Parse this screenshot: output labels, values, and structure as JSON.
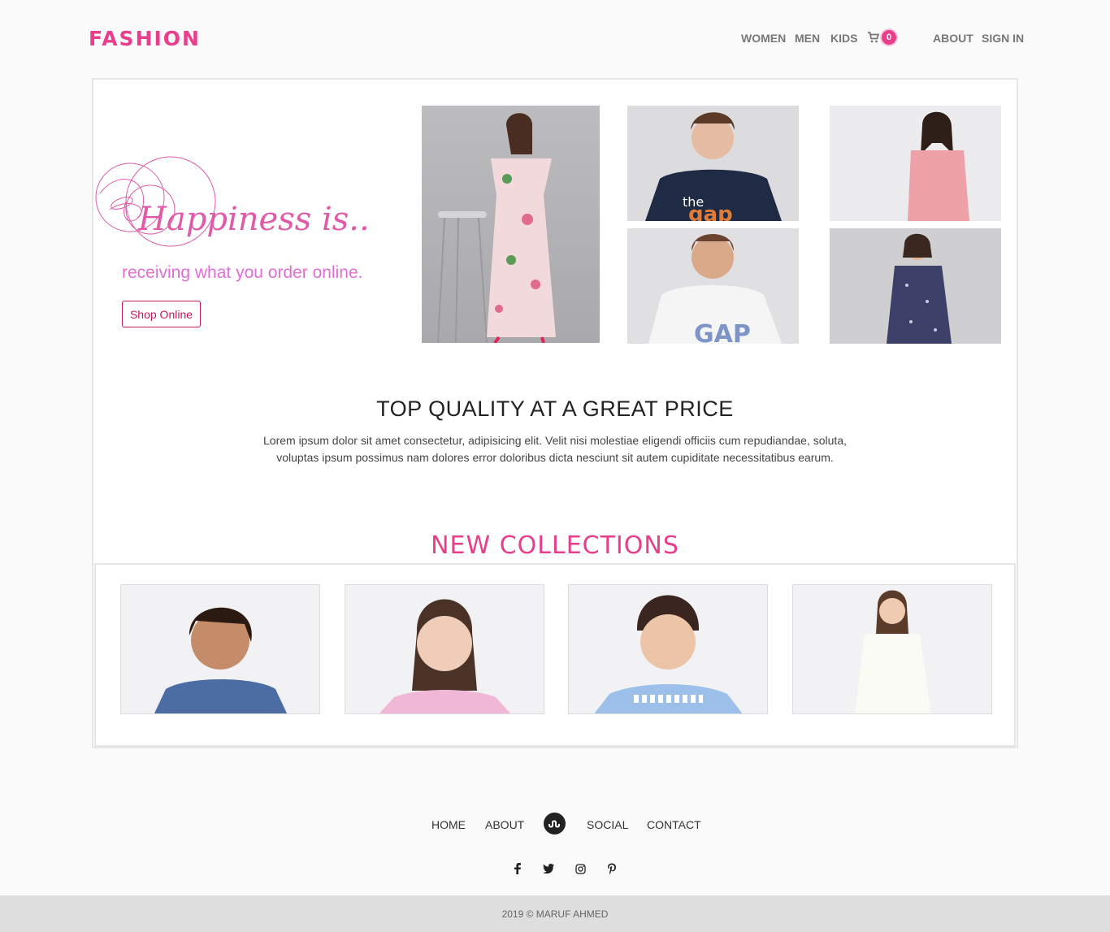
{
  "header": {
    "logo": "FASHION",
    "nav": [
      "WOMEN",
      "MEN",
      "KIDS",
      "ABOUT",
      "SIGN IN"
    ],
    "cart_count": "0"
  },
  "hero": {
    "script_title": "Happiness is...",
    "subtitle": "receiving what you order online.",
    "button": "Shop Online"
  },
  "quality": {
    "title": "TOP QUALITY AT A GREAT PRICE",
    "text": "Lorem ipsum dolor sit amet consectetur, adipisicing elit. Velit nisi molestiae eligendi officiis cum repudiandae, soluta, voluptas ipsum possimus nam dolores error doloribus dicta nesciunt sit autem cupiditate necessitatibus earum."
  },
  "collections": {
    "title": "NEW COLLECTIONS"
  },
  "footer": {
    "links": [
      "HOME",
      "ABOUT",
      "SOCIAL",
      "CONTACT"
    ],
    "social_icons": [
      "facebook-icon",
      "twitter-icon",
      "instagram-icon",
      "pinterest-icon"
    ],
    "copyright": "2019 © MARUF AHMED"
  },
  "colors": {
    "brand_pink": "#e83e8c",
    "subtitle_pink": "#e36dd6"
  }
}
